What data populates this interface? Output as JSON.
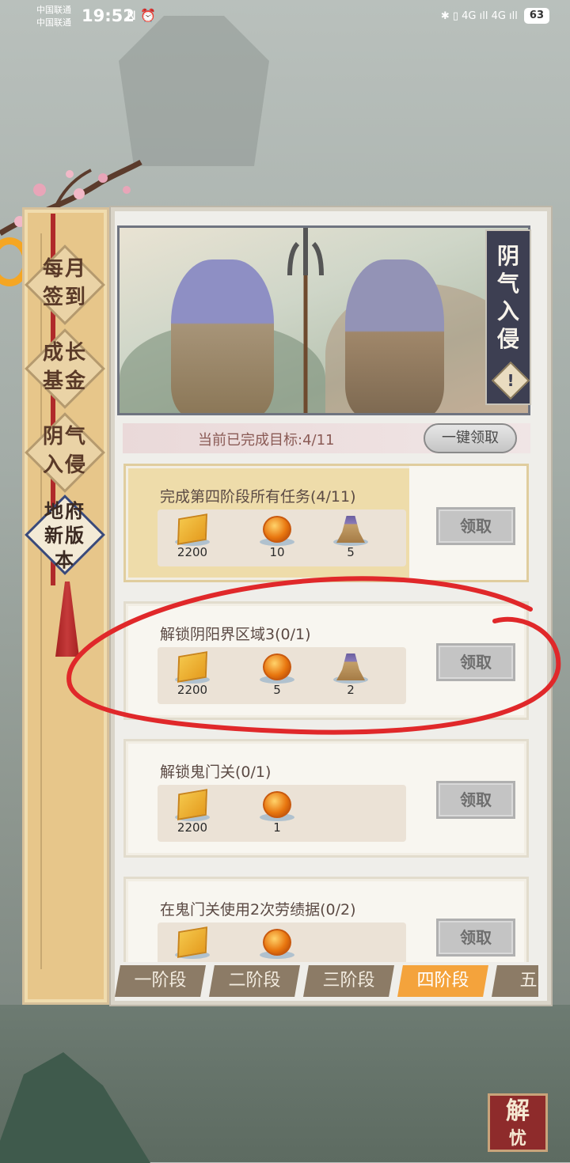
{
  "status_bar": {
    "carrier_1": "中国联通",
    "carrier_2": "中国联通",
    "time": "19:52",
    "left_icons": "N ⏰",
    "right_icons": "✱ ▯ 4G ıll 4G ıll",
    "battery": "63"
  },
  "sidebar": {
    "tabs": [
      {
        "label": "每月签到",
        "active": false
      },
      {
        "label": "成长基金",
        "active": false
      },
      {
        "label": "阴气入侵",
        "active": false
      },
      {
        "label": "地府新版本",
        "active": true
      }
    ]
  },
  "event": {
    "title": "阴气入侵",
    "info_icon": "!",
    "progress_label": "当前已完成目标:4/11",
    "claim_all_label": "一键领取"
  },
  "tasks": [
    {
      "name": "完成第四阶段所有任务(4/11)",
      "highlight": true,
      "rewards": [
        {
          "icon": "ticket-icon",
          "count": "2200"
        },
        {
          "icon": "orb-icon",
          "count": "10"
        },
        {
          "icon": "bell-icon",
          "count": "5"
        }
      ],
      "claim_label": "领取"
    },
    {
      "name": "解锁阴阳界区域3(0/1)",
      "highlight": false,
      "rewards": [
        {
          "icon": "ticket-icon",
          "count": "2200"
        },
        {
          "icon": "orb-icon",
          "count": "5"
        },
        {
          "icon": "bell-icon",
          "count": "2"
        }
      ],
      "claim_label": "领取"
    },
    {
      "name": "解锁鬼门关(0/1)",
      "highlight": false,
      "rewards": [
        {
          "icon": "ticket-icon",
          "count": "2200"
        },
        {
          "icon": "orb-icon",
          "count": "1"
        }
      ],
      "claim_label": "领取"
    },
    {
      "name": "在鬼门关使用2次劳绩据(0/2)",
      "highlight": false,
      "rewards": [
        {
          "icon": "ticket-icon",
          "count": ""
        },
        {
          "icon": "orb-icon",
          "count": ""
        }
      ],
      "claim_label": "领取"
    }
  ],
  "stages": [
    {
      "label": "一阶段",
      "active": false
    },
    {
      "label": "二阶段",
      "active": false
    },
    {
      "label": "三阶段",
      "active": false
    },
    {
      "label": "四阶段",
      "active": true
    },
    {
      "label": "五阶",
      "active": false
    }
  ],
  "corner_seal": {
    "line1": "解",
    "line2": "忧"
  },
  "colors": {
    "accent_orange": "#f4a33c",
    "annotation_red": "#e0282a",
    "seal_red": "#8e2b2b"
  }
}
